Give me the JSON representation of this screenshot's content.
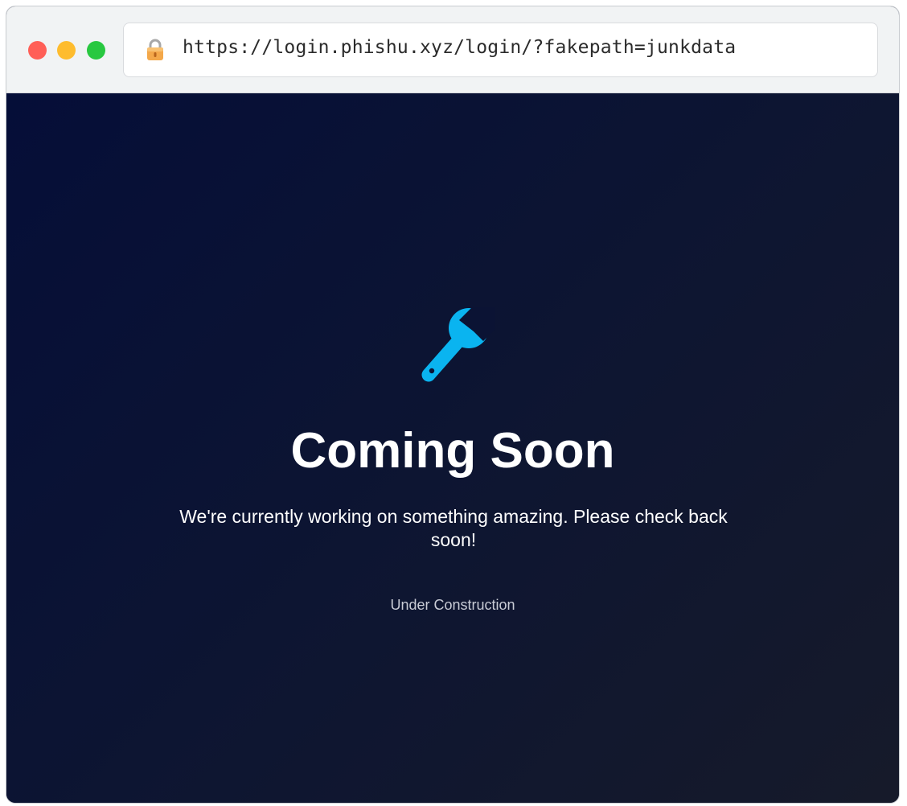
{
  "browser": {
    "url": "https://login.phishu.xyz/login/?fakepath=junkdata",
    "lock_icon": "lock-icon",
    "window_controls": [
      "close",
      "minimize",
      "maximize"
    ]
  },
  "page": {
    "icon": "wrench-icon",
    "title": "Coming Soon",
    "message": "We're currently working on something amazing. Please check back soon!",
    "status": "Under Construction"
  },
  "colors": {
    "accent": "#0ab4f0",
    "background": "#0c1230",
    "text": "#ffffff"
  }
}
